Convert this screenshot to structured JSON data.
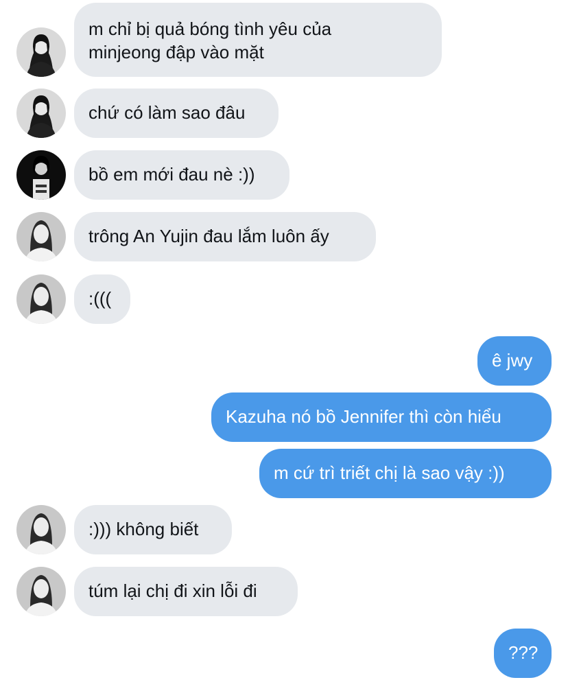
{
  "conversation": {
    "messages": [
      {
        "text_1": "m chỉ bị quả bóng tình yêu của",
        "text_2": "minjeong đập vào mặt",
        "sender_avatar": "avatar-dark-hair-girl-1"
      },
      {
        "text": "chứ có làm sao đâu",
        "sender_avatar": "avatar-dark-hair-girl-1"
      },
      {
        "text": "bồ em mới đau nè :))",
        "sender_avatar": "avatar-dark-hair-girl-2"
      },
      {
        "text": "trông An Yujin đau lắm luôn ấy",
        "sender_avatar": "avatar-smiling-girl"
      },
      {
        "text": ":(((",
        "sender_avatar": "avatar-smiling-girl"
      },
      {
        "text": "ê jwy"
      },
      {
        "text": "Kazuha nó bồ Jennifer thì còn hiểu"
      },
      {
        "text": "m cứ trì triết chị là sao vậy :))"
      },
      {
        "text": ":))) không biết",
        "sender_avatar": "avatar-smiling-girl"
      },
      {
        "text": "túm lại chị đi xin lỗi đi",
        "sender_avatar": "avatar-smiling-girl"
      },
      {
        "text": "???"
      }
    ]
  },
  "colors": {
    "incoming_bubble": "#e6e9ed",
    "outgoing_bubble": "#4a99e9",
    "incoming_text": "#111418",
    "outgoing_text": "#ffffff"
  }
}
